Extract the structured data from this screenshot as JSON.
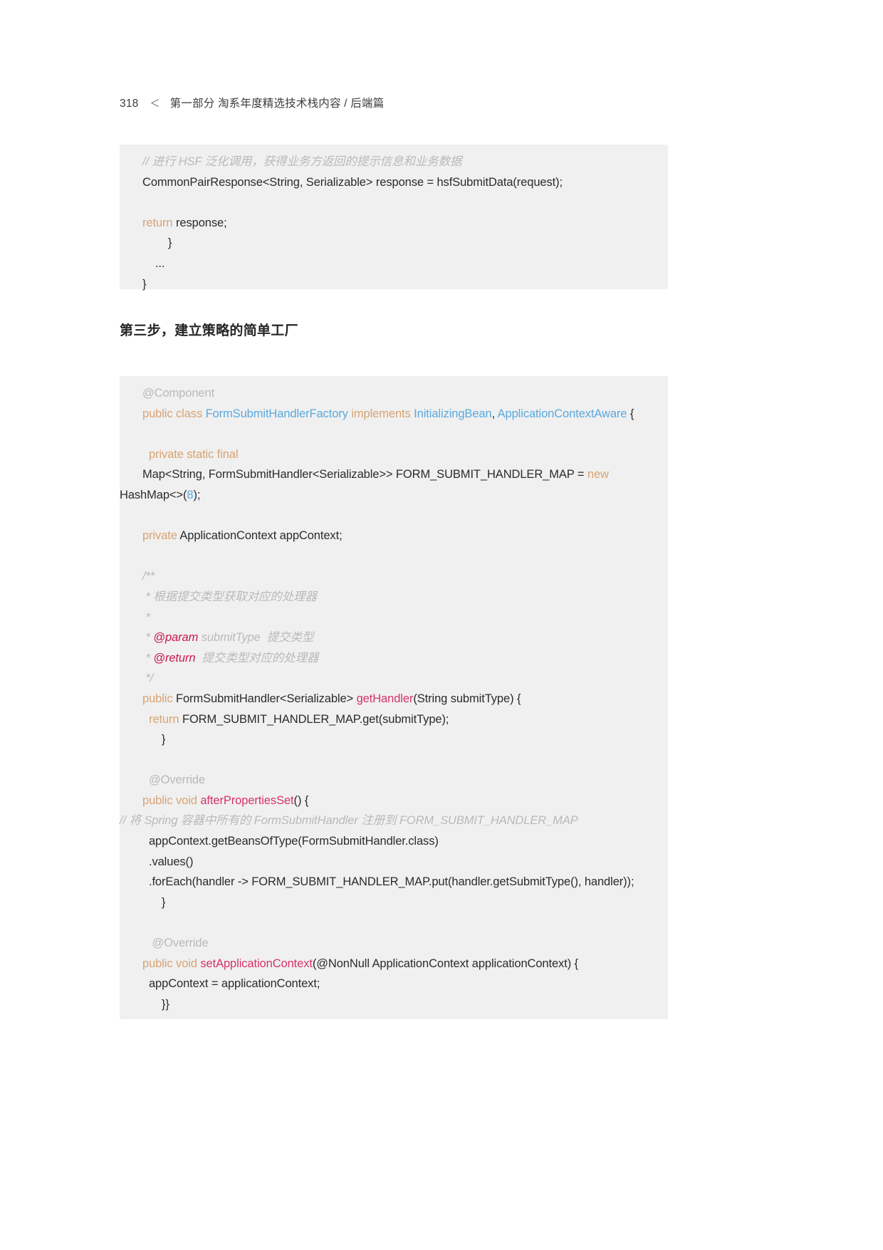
{
  "page": {
    "folio": "318",
    "chevron": "＜",
    "running_header": "第一部分  淘系年度精选技术栈内容  /  后端篇"
  },
  "heading": {
    "text": "第三步，建立策略的简单工厂"
  },
  "colors": {
    "code_background": "#f0f0f0",
    "comment": "#b9b9b9",
    "keyword": "#d8a373",
    "type": "#5aa9dd",
    "number": "#5aa9dd",
    "function": "#d6336c",
    "javadoc_tag": "#c9184a",
    "plain_text": "#2b2b2b",
    "page_background": "#ffffff"
  },
  "code_block_1": {
    "lines": [
      {
        "indent": "normal",
        "tokens": [
          {
            "text": "// 进行 HSF 泛化调用，获得业务方返回的提示信息和业务数据",
            "cls": "t-comment"
          }
        ]
      },
      {
        "indent": "normal",
        "tokens": [
          {
            "text": "CommonPairResponse<String, Serializable> response = hsfSubmitData(request);",
            "cls": "t-plain"
          }
        ]
      },
      {
        "indent": "normal",
        "tokens": [
          {
            "text": "",
            "cls": "t-plain"
          }
        ]
      },
      {
        "indent": "normal",
        "tokens": [
          {
            "text": "return",
            "cls": "t-kw"
          },
          {
            "text": " response;",
            "cls": "t-plain"
          }
        ]
      },
      {
        "indent": "normal",
        "tokens": [
          {
            "text": "        }",
            "cls": "t-plain"
          }
        ]
      },
      {
        "indent": "normal",
        "tokens": [
          {
            "text": "    ...",
            "cls": "t-plain"
          }
        ]
      },
      {
        "indent": "normal",
        "tokens": [
          {
            "text": "}",
            "cls": "t-plain"
          }
        ]
      }
    ]
  },
  "code_block_2": {
    "lines": [
      {
        "indent": "normal",
        "tokens": [
          {
            "text": "@Component",
            "cls": "t-anno"
          }
        ]
      },
      {
        "indent": "normal",
        "tokens": [
          {
            "text": "public class",
            "cls": "t-kw"
          },
          {
            "text": " ",
            "cls": "t-plain"
          },
          {
            "text": "FormSubmitHandlerFactory",
            "cls": "t-type"
          },
          {
            "text": " ",
            "cls": "t-plain"
          },
          {
            "text": "implements",
            "cls": "t-kw"
          },
          {
            "text": " ",
            "cls": "t-plain"
          },
          {
            "text": "InitializingBean",
            "cls": "t-type"
          },
          {
            "text": ", ",
            "cls": "t-plain"
          },
          {
            "text": "ApplicationContextAware",
            "cls": "t-type"
          },
          {
            "text": " {",
            "cls": "t-plain"
          }
        ]
      },
      {
        "indent": "normal",
        "tokens": [
          {
            "text": "",
            "cls": "t-plain"
          }
        ]
      },
      {
        "indent": "normal",
        "tokens": [
          {
            "text": "  private static final",
            "cls": "t-kw"
          }
        ]
      },
      {
        "indent": "normal",
        "tokens": [
          {
            "text": "Map<String, FormSubmitHandler<Serializable>> FORM_SUBMIT_HANDLER_MAP = ",
            "cls": "t-plain"
          },
          {
            "text": "new",
            "cls": "t-kw"
          }
        ]
      },
      {
        "indent": "flush",
        "tokens": [
          {
            "text": "HashMap<>(",
            "cls": "t-plain"
          },
          {
            "text": "8",
            "cls": "t-num"
          },
          {
            "text": ");",
            "cls": "t-plain"
          }
        ]
      },
      {
        "indent": "normal",
        "tokens": [
          {
            "text": "",
            "cls": "t-plain"
          }
        ]
      },
      {
        "indent": "normal",
        "tokens": [
          {
            "text": "private",
            "cls": "t-kw"
          },
          {
            "text": " ApplicationContext appContext;",
            "cls": "t-plain"
          }
        ]
      },
      {
        "indent": "normal",
        "tokens": [
          {
            "text": "",
            "cls": "t-plain"
          }
        ]
      },
      {
        "indent": "normal",
        "tokens": [
          {
            "text": "/**",
            "cls": "t-comment"
          }
        ]
      },
      {
        "indent": "normal",
        "tokens": [
          {
            "text": " * 根据提交类型获取对应的处理器",
            "cls": "t-comment"
          }
        ]
      },
      {
        "indent": "normal",
        "tokens": [
          {
            "text": " *",
            "cls": "t-comment"
          }
        ]
      },
      {
        "indent": "normal",
        "tokens": [
          {
            "text": " * ",
            "cls": "t-comment"
          },
          {
            "text": "@param",
            "cls": "t-tag"
          },
          {
            "text": " submitType  提交类型",
            "cls": "t-comment"
          }
        ]
      },
      {
        "indent": "normal",
        "tokens": [
          {
            "text": " * ",
            "cls": "t-comment"
          },
          {
            "text": "@return",
            "cls": "t-tag"
          },
          {
            "text": "  提交类型对应的处理器",
            "cls": "t-comment"
          }
        ]
      },
      {
        "indent": "normal",
        "tokens": [
          {
            "text": " */",
            "cls": "t-comment"
          }
        ]
      },
      {
        "indent": "normal",
        "tokens": [
          {
            "text": "public",
            "cls": "t-kw"
          },
          {
            "text": " FormSubmitHandler<Serializable> ",
            "cls": "t-plain"
          },
          {
            "text": "getHandler",
            "cls": "t-fn"
          },
          {
            "text": "(String submitType) {",
            "cls": "t-plain"
          }
        ]
      },
      {
        "indent": "normal",
        "tokens": [
          {
            "text": "  return",
            "cls": "t-kw"
          },
          {
            "text": " FORM_SUBMIT_HANDLER_MAP.get(submitType);",
            "cls": "t-plain"
          }
        ]
      },
      {
        "indent": "normal",
        "tokens": [
          {
            "text": "      }",
            "cls": "t-plain"
          }
        ]
      },
      {
        "indent": "normal",
        "tokens": [
          {
            "text": "",
            "cls": "t-plain"
          }
        ]
      },
      {
        "indent": "normal",
        "tokens": [
          {
            "text": "  @Override",
            "cls": "t-anno"
          }
        ]
      },
      {
        "indent": "normal",
        "tokens": [
          {
            "text": "public void",
            "cls": "t-kw"
          },
          {
            "text": " ",
            "cls": "t-plain"
          },
          {
            "text": "afterPropertiesSet",
            "cls": "t-fn"
          },
          {
            "text": "() {",
            "cls": "t-plain"
          }
        ]
      },
      {
        "indent": "flush",
        "tokens": [
          {
            "text": "// 将 Spring 容器中所有的 FormSubmitHandler 注册到 FORM_SUBMIT_HANDLER_MAP",
            "cls": "t-comment"
          }
        ]
      },
      {
        "indent": "normal",
        "tokens": [
          {
            "text": "  appContext.getBeansOfType(FormSubmitHandler.class)",
            "cls": "t-plain"
          }
        ]
      },
      {
        "indent": "normal",
        "tokens": [
          {
            "text": "  .values()",
            "cls": "t-plain"
          }
        ]
      },
      {
        "indent": "normal",
        "tokens": [
          {
            "text": "  .forEach(handler -> FORM_SUBMIT_HANDLER_MAP.put(handler.getSubmitType(), handler));",
            "cls": "t-plain"
          }
        ]
      },
      {
        "indent": "normal",
        "tokens": [
          {
            "text": "      }",
            "cls": "t-plain"
          }
        ]
      },
      {
        "indent": "normal",
        "tokens": [
          {
            "text": "",
            "cls": "t-plain"
          }
        ]
      },
      {
        "indent": "normal",
        "tokens": [
          {
            "text": "   @Override",
            "cls": "t-anno"
          }
        ]
      },
      {
        "indent": "normal",
        "tokens": [
          {
            "text": "public void",
            "cls": "t-kw"
          },
          {
            "text": " ",
            "cls": "t-plain"
          },
          {
            "text": "setApplicationContext",
            "cls": "t-fn"
          },
          {
            "text": "(@NonNull ApplicationContext applicationContext) {",
            "cls": "t-plain"
          }
        ]
      },
      {
        "indent": "normal",
        "tokens": [
          {
            "text": "  appContext = applicationContext;",
            "cls": "t-plain"
          }
        ]
      },
      {
        "indent": "normal",
        "tokens": [
          {
            "text": "      }}",
            "cls": "t-plain"
          }
        ]
      }
    ]
  }
}
